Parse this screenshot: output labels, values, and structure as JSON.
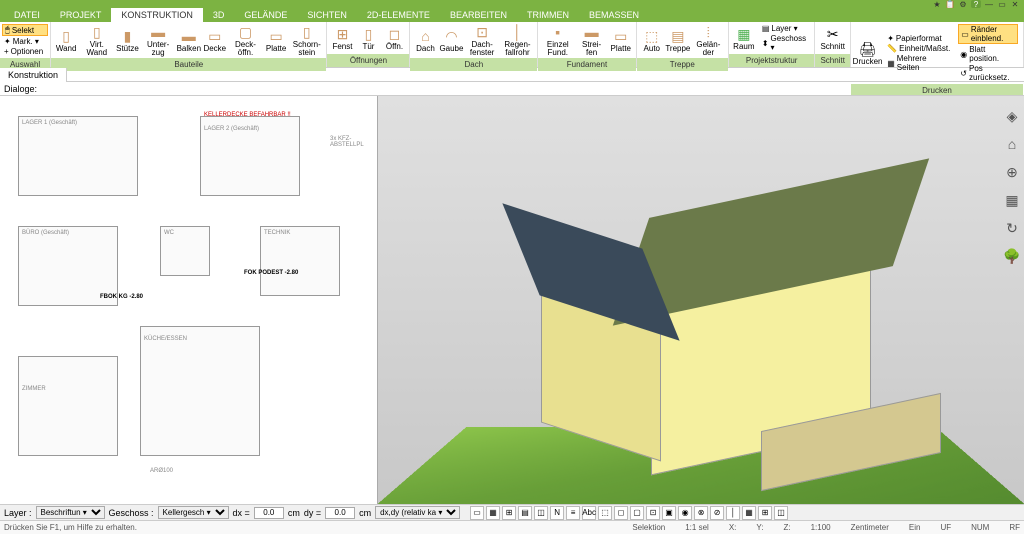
{
  "titleicons": [
    "★",
    "📋",
    "⚙",
    "?",
    "▭",
    "—",
    "✕"
  ],
  "tabs": [
    "DATEI",
    "PROJEKT",
    "KONSTRUKTION",
    "3D",
    "GELÄNDE",
    "SICHTEN",
    "2D-ELEMENTE",
    "BEARBEITEN",
    "TRIMMEN",
    "BEMASSEN"
  ],
  "active_tab": 2,
  "ribbon": {
    "auswahl": {
      "label": "Auswahl",
      "selekt": "Selekt",
      "mark": "Mark. ▾",
      "optionen": "Optionen"
    },
    "bauteile": {
      "label": "Bauteile",
      "items": [
        {
          "l": "Wand",
          "i": "▯"
        },
        {
          "l": "Virt. Wand",
          "i": "▯"
        },
        {
          "l": "Stütze",
          "i": "▮"
        },
        {
          "l": "Unter- zug",
          "i": "▬"
        },
        {
          "l": "Balken",
          "i": "▬"
        },
        {
          "l": "Decke",
          "i": "▭"
        },
        {
          "l": "Deck- öffn.",
          "i": "▢"
        },
        {
          "l": "Platte",
          "i": "▭"
        },
        {
          "l": "Schorn- stein",
          "i": "▯"
        }
      ]
    },
    "oeffnungen": {
      "label": "Öffnungen",
      "items": [
        {
          "l": "Fenst",
          "i": "⊞"
        },
        {
          "l": "Tür",
          "i": "▯"
        },
        {
          "l": "Öffn.",
          "i": "◻"
        }
      ]
    },
    "dach": {
      "label": "Dach",
      "items": [
        {
          "l": "Dach",
          "i": "⌂"
        },
        {
          "l": "Gaube",
          "i": "◠"
        },
        {
          "l": "Dach- fenster",
          "i": "⊡"
        },
        {
          "l": "Regen- fallrohr",
          "i": "│"
        }
      ]
    },
    "fundament": {
      "label": "Fundament",
      "items": [
        {
          "l": "Einzel Fund.",
          "i": "▪"
        },
        {
          "l": "Strei- fen",
          "i": "▬"
        },
        {
          "l": "Platte",
          "i": "▭"
        }
      ]
    },
    "treppe": {
      "label": "Treppe",
      "items": [
        {
          "l": "Auto",
          "i": "⬚"
        },
        {
          "l": "Treppe",
          "i": "▤"
        },
        {
          "l": "Gelän- der",
          "i": "⦙"
        }
      ]
    },
    "projekt": {
      "label": "Projektstruktur",
      "raum": "Raum",
      "layer": "Layer ▾",
      "geschoss": "Geschoss ▾"
    },
    "schnitt": {
      "label": "Schnitt",
      "l": "Schnitt"
    },
    "drucken": {
      "label": "Drucken",
      "drucken": "Drucken",
      "rows": [
        "Papierformat",
        "Einheit/Maßst.",
        "Mehrere Seiten",
        "Ränder einblend.",
        "Blatt position.",
        "Pos zurücksetz."
      ]
    }
  },
  "subtab": "Konstruktion",
  "dialoge": "Dialoge:",
  "plan": {
    "red": "KELLERDECKE BEFAHRBAR !!",
    "rooms": [
      "LAGER 1 (Geschäft)",
      "LAGER 2 (Geschäft)",
      "BÜRO (Geschäft)",
      "WC",
      "TECHNIK",
      "ZIMMER",
      "KÜCHE/ESSEN"
    ],
    "parking": "3x KFZ- ABSTELLPL",
    "fbok": "FBOK KG -2.80",
    "podest": "FOK PODEST -2.80",
    "ar": "ARØ100"
  },
  "rtools": [
    "◈",
    "⌂",
    "⊕",
    "▦",
    "↻",
    "🌳"
  ],
  "bottom": {
    "layer_l": "Layer :",
    "layer_v": "Beschriftun ▾",
    "geschoss_l": "Geschoss :",
    "geschoss_v": "Kellergesch ▾",
    "dx": "dx =",
    "dy": "dy =",
    "val": "0.0",
    "cm": "cm",
    "mode": "dx,dy (relativ ka ▾",
    "icons": [
      "▭",
      "▦",
      "⊞",
      "▤",
      "◫",
      "N",
      "≡",
      "Abc",
      "⬚",
      "◻",
      "▢",
      "⊡",
      "▣",
      "◉",
      "⊗",
      "⊘",
      "│",
      "▦",
      "⊞",
      "◫"
    ]
  },
  "status": {
    "help": "Drücken Sie F1, um Hilfe zu erhalten.",
    "sel": "Selektion",
    "ratio": "1:1 sel",
    "x": "X:",
    "y": "Y:",
    "z": "Z:",
    "scale": "1:100",
    "unit": "Zentimeter",
    "ein": "Ein",
    "uf": "UF",
    "num": "NUM",
    "rf": "RF"
  }
}
